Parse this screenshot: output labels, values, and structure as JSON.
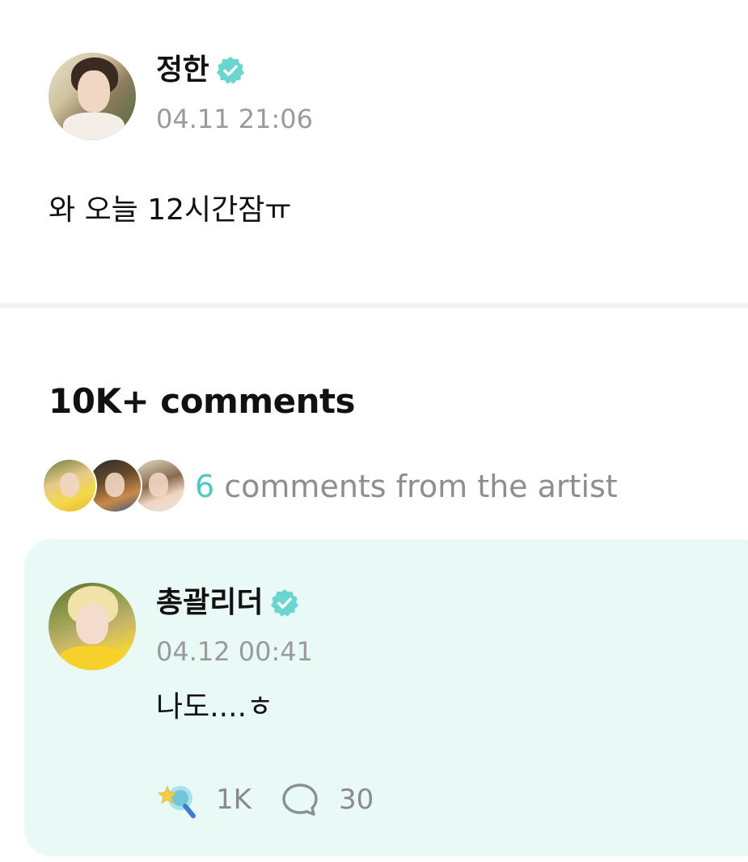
{
  "post": {
    "author": "정한",
    "author_verified": true,
    "timestamp": "04.11 21:06",
    "body": "와 오늘 12시간잠ㅠ"
  },
  "comments_section": {
    "count_label": "10K+ comments",
    "artist_comments": {
      "count": "6",
      "label": " comments from the artist"
    }
  },
  "comment": {
    "author": "총괄리더",
    "author_verified": true,
    "timestamp": "04.12 00:41",
    "text": "나도....ㅎ",
    "likes": "1K",
    "replies": "30"
  },
  "colors": {
    "accent": "#4cc9c0",
    "verified_badge": "#6bd6d0",
    "card_background": "#e9f9f6",
    "secondary_text": "#9a9a9a"
  },
  "icons": {
    "verified": "verified-badge-icon",
    "like": "star-wand-icon",
    "reply": "speech-bubble-icon"
  }
}
